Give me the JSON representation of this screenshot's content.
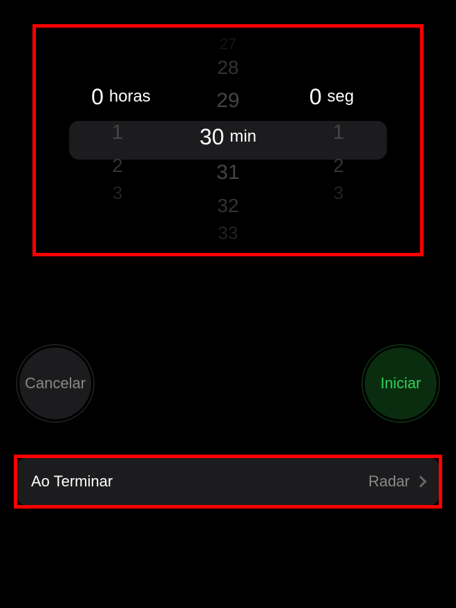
{
  "picker": {
    "hours": {
      "selected": "0",
      "unit": "horas",
      "above": [],
      "below": [
        "1",
        "2",
        "3"
      ]
    },
    "minutes": {
      "selected": "30",
      "unit": "min",
      "above": [
        "27",
        "28",
        "29"
      ],
      "below": [
        "31",
        "32",
        "33"
      ]
    },
    "seconds": {
      "selected": "0",
      "unit": "seg",
      "above": [],
      "below": [
        "1",
        "2",
        "3"
      ]
    }
  },
  "buttons": {
    "cancel": "Cancelar",
    "start": "Iniciar"
  },
  "settings": {
    "label": "Ao Terminar",
    "value": "Radar"
  }
}
